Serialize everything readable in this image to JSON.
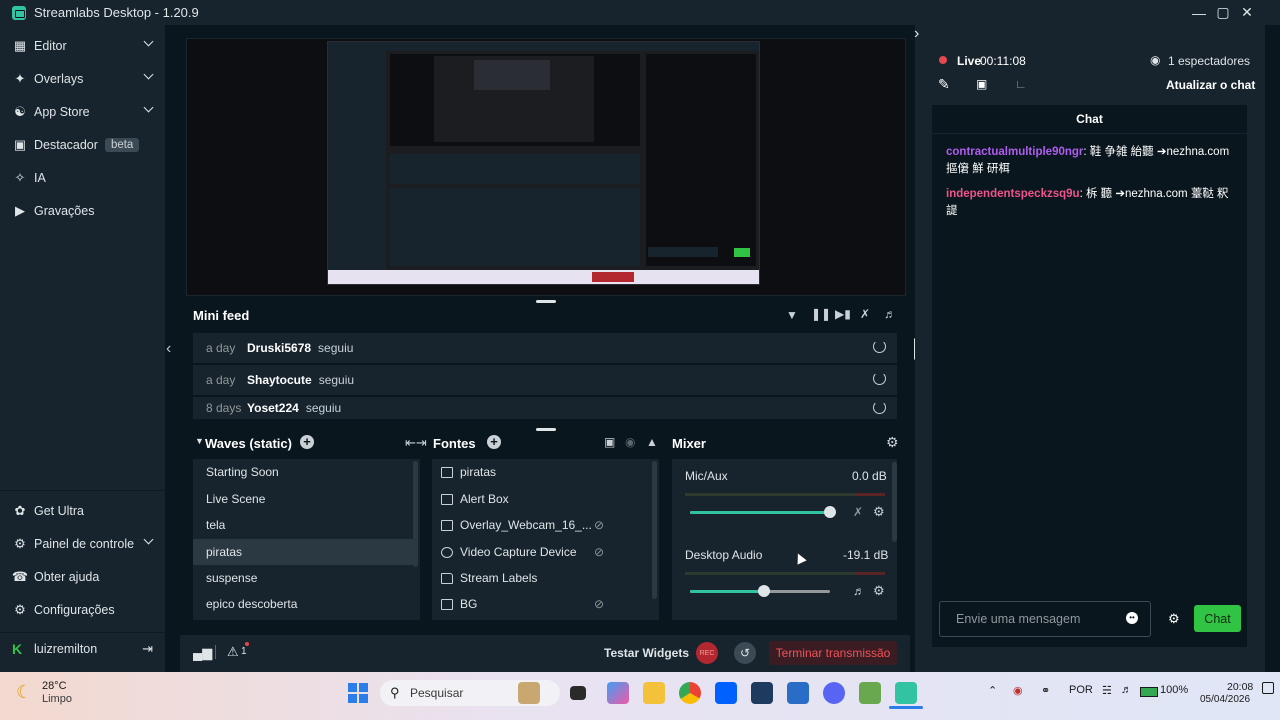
{
  "window": {
    "title": "Streamlabs Desktop - 1.20.9"
  },
  "sidebar": {
    "top_items": [
      {
        "label": "Editor",
        "icon": "editor-icon",
        "has_chevron": true
      },
      {
        "label": "Overlays",
        "icon": "overlays-icon",
        "has_chevron": true
      },
      {
        "label": "App Store",
        "icon": "app-store-icon",
        "has_chevron": true
      },
      {
        "label": "Destacador",
        "icon": "highlighter-icon",
        "badge": "beta"
      },
      {
        "label": "IA",
        "icon": "ai-sparkle-icon"
      },
      {
        "label": "Gravações",
        "icon": "recordings-icon"
      }
    ],
    "bottom_items": [
      {
        "label": "Get Ultra",
        "icon": "ultra-icon"
      },
      {
        "label": "Painel de controle",
        "icon": "dashboard-icon",
        "has_chevron": true
      },
      {
        "label": "Obter ajuda",
        "icon": "help-icon"
      },
      {
        "label": "Configurações",
        "icon": "settings-icon"
      }
    ],
    "user": {
      "name": "luizremilton",
      "logout_icon": "logout-icon"
    }
  },
  "mini_feed": {
    "title": "Mini feed",
    "rows": [
      {
        "ago": "a day",
        "user": "Druski5678",
        "action": "seguiu"
      },
      {
        "ago": "a day",
        "user": "Shaytocute",
        "action": "seguiu"
      },
      {
        "ago": "8 days",
        "user": "Yoset224",
        "action": "seguiu"
      }
    ]
  },
  "scenes": {
    "title": "Waves (static)",
    "items": [
      "Starting Soon",
      "Live Scene",
      "tela",
      "piratas",
      "suspense",
      "epico descoberta"
    ],
    "selected_index": 3
  },
  "sources": {
    "title": "Fontes",
    "items": [
      {
        "label": "piratas",
        "icon": "image-icon"
      },
      {
        "label": "Alert Box",
        "icon": "alert-box-icon"
      },
      {
        "label": "Overlay_Webcam_16_...",
        "icon": "image-icon",
        "hidden": true
      },
      {
        "label": "Video Capture Device",
        "icon": "webcam-icon",
        "hidden": true
      },
      {
        "label": "Stream Labels",
        "icon": "folder-icon"
      },
      {
        "label": "BG",
        "icon": "image-icon",
        "hidden": true
      }
    ]
  },
  "mixer": {
    "title": "Mixer",
    "channels": [
      {
        "name": "Mic/Aux",
        "db": "0.0 dB",
        "level": 1.0,
        "muted": true
      },
      {
        "name": "Desktop Audio",
        "db": "-19.1 dB",
        "level": 0.53,
        "muted": false
      }
    ]
  },
  "footer": {
    "test_widgets": "Testar Widgets",
    "rec": "REC",
    "end_stream": "Terminar transmissão",
    "alert_count": "1"
  },
  "live": {
    "status": "Live",
    "timer": "00:11:08",
    "viewers": "1 espectadores",
    "refresh_chat": "Atualizar o chat"
  },
  "chat": {
    "tab": "Chat",
    "messages": [
      {
        "user": "contractualmultiple90ngr",
        "text": ": 鞋 争雑 紿聽 ➔nezhna.com 摳僒 鮮 研栮",
        "color": "#b05cf0"
      },
      {
        "user": "independentspeckzsq9u",
        "text": ": 柝 聽 ➔nezhna.com 薹鞑 粎諟",
        "color": "#f0538a"
      }
    ],
    "input_placeholder": "Envie uma mensagem",
    "send_label": "Chat"
  },
  "taskbar": {
    "weather_temp": "28°C",
    "weather_desc": "Limpo",
    "search_placeholder": "Pesquisar",
    "lang": "POR",
    "battery": "100%",
    "time": "20:08",
    "date": "05/04/2026"
  },
  "colors": {
    "accent": "#31c3a2",
    "live_dot": "#e5484d",
    "send_button": "#31c344",
    "end_button_text": "#f0535a"
  }
}
